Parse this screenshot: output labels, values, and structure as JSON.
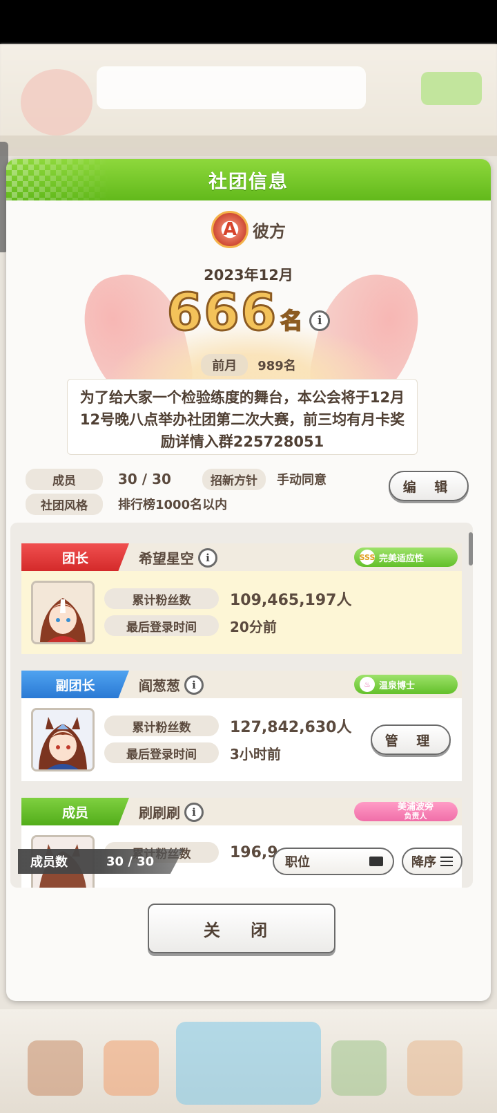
{
  "dialog": {
    "title": "社团信息"
  },
  "club": {
    "emblem_letter": "A",
    "name": "彼方",
    "month": "2023年12月",
    "rank": "666",
    "rank_unit": "名",
    "prev_label": "前月",
    "prev_rank": "989名",
    "notice": "为了给大家一个检验练度的舞台，本公会将于12月12号晚八点举办社团第二次大赛，前三均有月卡奖励详情入群225728051"
  },
  "meta": {
    "members_label": "成员",
    "members_value": "30 / 30",
    "policy_label": "招新方针",
    "policy_value": "手动同意",
    "style_label": "社团风格",
    "style_value": "排行榜1000名以内",
    "edit_label": "编 辑"
  },
  "members": [
    {
      "role": "团长",
      "name": "希望星空",
      "badge": "完美适应性",
      "badge_icon": "SSS",
      "fans_label": "累计粉丝数",
      "fans": "109,465,197人",
      "login_label": "最后登录时间",
      "login": "20分前"
    },
    {
      "role": "副团长",
      "name": "阎葱葱",
      "badge": "温泉博士",
      "fans_label": "累计粉丝数",
      "fans": "127,842,630人",
      "login_label": "最后登录时间",
      "login": "3小时前",
      "manage_label": "管 理"
    },
    {
      "role": "成员",
      "name": "刷刷刷",
      "badge": "美浦波旁",
      "badge_sub": "负责人",
      "fans_label": "累计粉丝数",
      "fans": "196,9"
    }
  ],
  "footer": {
    "count_label": "成员数",
    "count_value": "30 / 30",
    "position_label": "职位",
    "order_label": "降序",
    "close_label": "关 闭"
  },
  "colors": {
    "header_green": "#62b91b",
    "leader_red": "#d42a2a",
    "vice_blue": "#2a79d4",
    "member_green": "#52ad1a",
    "rank_gold": "#f3c25a"
  }
}
